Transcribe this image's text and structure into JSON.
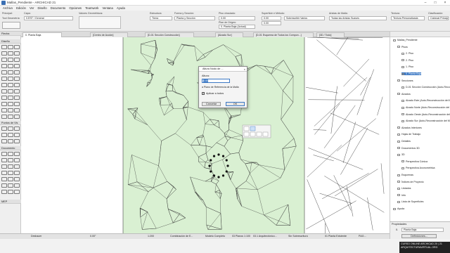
{
  "window": {
    "title": "Mallas_Pendiente - ARCHICAD 21",
    "controls": [
      "–",
      "□",
      "×"
    ]
  },
  "menu": [
    "Archivo",
    "Edición",
    "Ver",
    "Diseño",
    "Documento",
    "Opciones",
    "Teamwork",
    "Ventana",
    "Ayuda"
  ],
  "infobox": {
    "principal_label": "Principal:",
    "tool_label": "Tool Geometría",
    "capa_label": "Capa:",
    "capa_value": "0.EST / General",
    "valores_label": "Valores Geométricos:",
    "estructura_label": "Estructura:",
    "estructura_value": "Tierra",
    "forma_label": "Forma y Sección:",
    "forma_value": "Planta y Sección",
    "piso_label": "Piso vinculado:",
    "piso_value": "0. Planta Baja (Actual)",
    "superficie_label": "Superficie e Método:",
    "superficie_value": "Sobrescribir Varios",
    "aristas_label": "Aristas de Malla:",
    "aristas_value": "Todas las Aristas Suaves",
    "textura_label": "Textura:",
    "textura_value": "Textura Personalizada",
    "clasif_label": "Clasificación:",
    "clasif_value": "Cabezal Principal",
    "dim1": "0.00",
    "dim2": "0.00",
    "plan_origen_label": "Plan de Origen:",
    "dim3": "0.00"
  },
  "toolbox": {
    "header_seleccion": "Flecha",
    "header_diseno": "Diseño",
    "header_documento": "Documento",
    "header_puntos": "Puntos de Vis",
    "header_mep": "MEP"
  },
  "tabs": [
    "0. Planta Baja",
    "[Centro de Acción]",
    "[D-01 Sección Construcción]",
    "[Alzado Sur]",
    "[D-01 Esquema de Todos los Compon...]",
    "[3D / Todo]"
  ],
  "dialog": {
    "title": "Altura Nodo de ...",
    "altura_label": "Altura:",
    "altura_value": "0.00",
    "ref_label": "a Plano de Referencia de la Malla",
    "apply_all_label": "Aplicar a todos",
    "cancel_label": "Cancelar",
    "ok_label": "OK"
  },
  "navigator": {
    "items": [
      {
        "label": "Mallas_Pendiente",
        "level": 0
      },
      {
        "label": "Pisos",
        "level": 1
      },
      {
        "label": "2. Piso",
        "level": 2
      },
      {
        "label": "2. Piso",
        "level": 2
      },
      {
        "label": "1. Piso",
        "level": 2
      },
      {
        "label": "0. Planta Baja",
        "level": 2,
        "selected": true
      },
      {
        "label": "Secciones",
        "level": 1
      },
      {
        "label": "D-01 Sección Construcción (Auto-Reconstrucción)",
        "level": 2
      },
      {
        "label": "Alzados",
        "level": 1
      },
      {
        "label": "Alzado Este (Auto-Reconstrucción del M...",
        "level": 2
      },
      {
        "label": "Alzado Norte (Auto-Reconstrucción del M...",
        "level": 2
      },
      {
        "label": "Alzado Oeste (Auto-Reconstrucción del M...",
        "level": 2
      },
      {
        "label": "Alzado Sur (Auto-Reconstrucción del M...",
        "level": 2
      },
      {
        "label": "Alzados Interiores",
        "level": 1
      },
      {
        "label": "Hojas de Trabajo",
        "level": 1
      },
      {
        "label": "Detalles",
        "level": 1
      },
      {
        "label": "Documentos 3D",
        "level": 1
      },
      {
        "label": "3D",
        "level": 1
      },
      {
        "label": "Perspectiva Cónica",
        "level": 2
      },
      {
        "label": "Perspectiva Axonométrica",
        "level": 2
      },
      {
        "label": "Esquemas",
        "level": 1
      },
      {
        "label": "Índices de Proyecto",
        "level": 1
      },
      {
        "label": "Listados",
        "level": 1
      },
      {
        "label": "Info",
        "level": 1
      },
      {
        "label": "Lista de Superficies",
        "level": 1
      },
      {
        "label": "Ayuda",
        "level": 0
      }
    ]
  },
  "props": {
    "title": "Propiedades",
    "row_label": "0.",
    "row_value": "Planta Baja",
    "definitions_button": "Definiciones..."
  },
  "status": {
    "undo": "Deshacer",
    "zoom": "0.00°",
    "scale": "1:200",
    "combinacion": "Combinación de E...",
    "modelo": "Modelo Completo",
    "planos": "03 Planos 1:100",
    "arquitectonico": "03.1 Arquitectónico...",
    "sobrescritura": "Sin Sobrescritura",
    "planta_existente": "01 Planta Existente",
    "p_zero": "P&G..."
  },
  "watermark": {
    "line1": "CURSO ONLINE ARCHICAD 20 | 21",
    "line2": "ARQUITECTURAVIRTUAL.ORG"
  },
  "colors": {
    "green_panel": "#d9f0d2",
    "selection_blue": "#3b78c4"
  }
}
